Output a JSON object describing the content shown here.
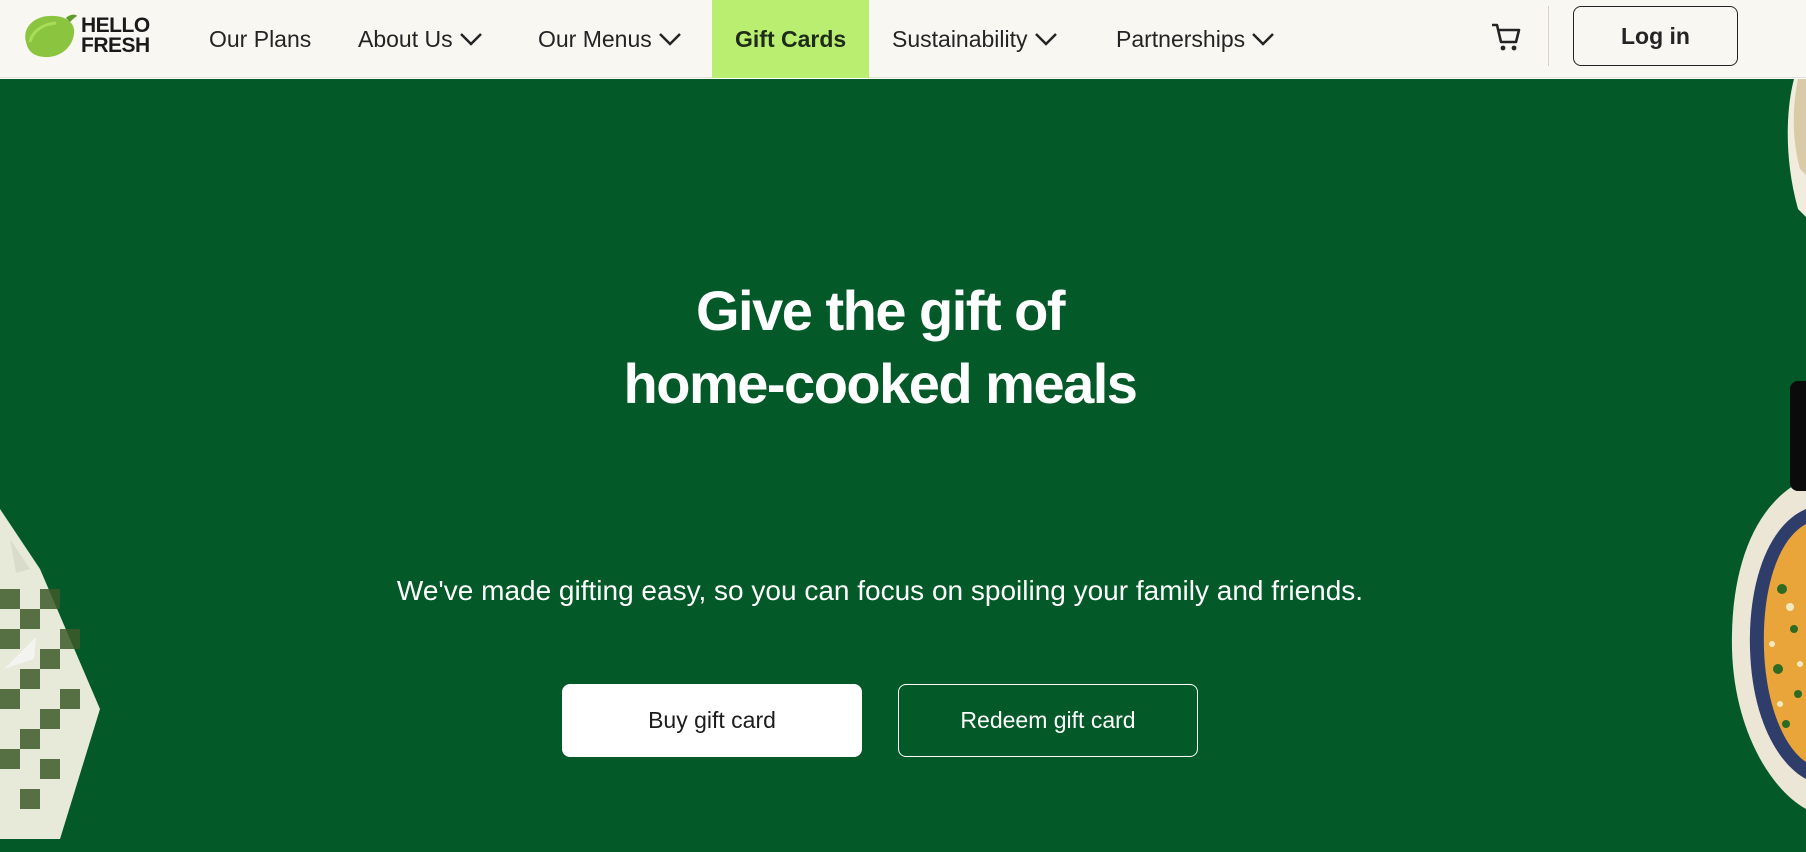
{
  "brand": {
    "name_line1": "HELLO",
    "name_line2": "FRESH",
    "lime_color": "#8bc53f"
  },
  "nav": {
    "items": [
      {
        "label": "Our Plans",
        "has_dropdown": false
      },
      {
        "label": "About Us",
        "has_dropdown": true
      },
      {
        "label": "Our Menus",
        "has_dropdown": true
      },
      {
        "label": "Gift Cards",
        "has_dropdown": false,
        "active": true
      },
      {
        "label": "Sustainability",
        "has_dropdown": true
      },
      {
        "label": "Partnerships",
        "has_dropdown": true
      }
    ],
    "cart_icon": "cart-icon",
    "login_label": "Log in"
  },
  "hero": {
    "title_line1": "Give the gift of",
    "title_line2": "home-cooked meals",
    "subtitle": "We've made gifting easy, so you can focus on spoiling your family and friends.",
    "buy_label": "Buy gift card",
    "redeem_label": "Redeem gift card"
  },
  "colors": {
    "hero_bg": "#035a28",
    "header_bg": "#f9f7f2",
    "active_tab": "#b9ee71"
  }
}
